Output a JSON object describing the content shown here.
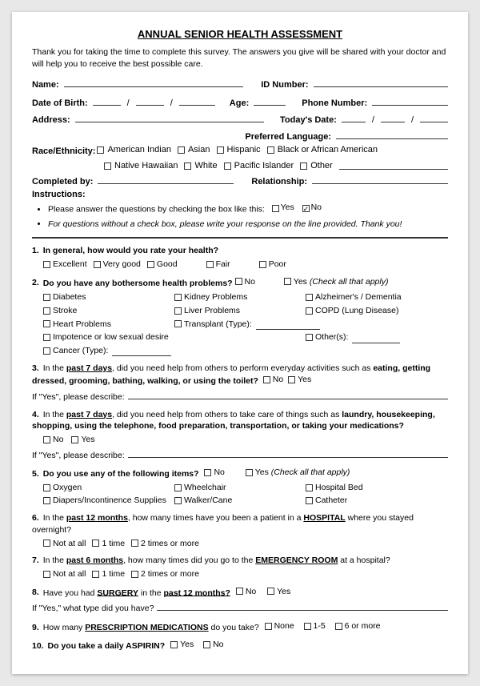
{
  "title": "ANNUAL SENIOR HEALTH ASSESSMENT",
  "intro": "Thank you for taking the time to complete this survey. The answers you give will be shared with your doctor and will help you to receive the best possible care.",
  "fields": {
    "name_label": "Name:",
    "id_number_label": "ID Number:",
    "dob_label": "Date of Birth:",
    "age_label": "Age:",
    "phone_label": "Phone Number:",
    "address_label": "Address:",
    "todays_date_label": "Today's Date:",
    "preferred_lang_label": "Preferred Language:",
    "race_label": "Race/Ethnicity:",
    "completed_by_label": "Completed by:",
    "relationship_label": "Relationship:"
  },
  "race_options": [
    "American Indian",
    "Asian",
    "Hispanic",
    "Black or African American",
    "Native Hawaiian",
    "White",
    "Pacific Islander",
    "Other"
  ],
  "instructions_header": "Instructions:",
  "instructions": [
    "Please answer the questions by checking the box like this:",
    "For questions without a check box, please write your response on the line provided. Thank you!"
  ],
  "questions": [
    {
      "num": "1.",
      "text": "In general, how would you rate your health?",
      "options": [
        "Excellent",
        "Very good",
        "Good",
        "Fair",
        "Poor"
      ]
    },
    {
      "num": "2.",
      "text": "Do you have any bothersome health problems?",
      "inline_options": [
        "No",
        "Yes (Check all that apply)"
      ],
      "sub_options": [
        "Diabetes",
        "Kidney Problems",
        "Alzheimer's / Dementia",
        "Stroke",
        "Liver Problems",
        "COPD (Lung Disease)",
        "Heart Problems",
        "Transplant (Type):",
        "Impotence or low sexual desire",
        "Other(s):",
        "Cancer (Type):"
      ]
    },
    {
      "num": "3.",
      "text_parts": [
        "In the ",
        "past 7 days",
        ", did you need help from others to perform everyday activities such as ",
        "eating, getting dressed, grooming, bathing, walking, or using the toilet?",
        "  No    Yes"
      ],
      "if_yes": "If \"Yes\", please describe:"
    },
    {
      "num": "4.",
      "text_parts": [
        "In the ",
        "past 7 days",
        ", did you need help from others to take care of things such as ",
        "laundry, housekeeping, shopping, using the telephone, food preparation, transportation, or taking your medications?",
        "  No    Yes"
      ],
      "if_yes": "If \"Yes\", please describe:"
    },
    {
      "num": "5.",
      "text": "Do you use any of the following items?",
      "inline_options": [
        "No",
        "Yes (Check all that apply)"
      ],
      "sub_options": [
        "Oxygen",
        "Wheelchair",
        "Hospital Bed",
        "Diapers/Incontinence Supplies",
        "Walker/Cane",
        "Catheter"
      ]
    },
    {
      "num": "6.",
      "text_parts": [
        "In the ",
        "past 12 months",
        ", how many times have you been a patient in a ",
        "HOSPITAL",
        " where you stayed overnight?",
        "  Not at all    1 time    2 times or more"
      ]
    },
    {
      "num": "7.",
      "text_parts": [
        "In the ",
        "past 6 months",
        ", how many times did you go to the ",
        "EMERGENCY ROOM",
        " at a hospital?",
        "  Not at all    1 time    2 times or more"
      ]
    },
    {
      "num": "8.",
      "text_parts": [
        "Have you had ",
        "SURGERY",
        " in the ",
        "past 12 months?",
        "  No    Yes"
      ],
      "if_yes": "If \"Yes,\" what type did you have?"
    },
    {
      "num": "9.",
      "text_parts": [
        "How many ",
        "PRESCRIPTION MEDICATIONS",
        " do you take?  None    1-5    6 or more"
      ]
    },
    {
      "num": "10.",
      "text": "Do you take a daily ASPIRIN?  Yes    No"
    }
  ]
}
